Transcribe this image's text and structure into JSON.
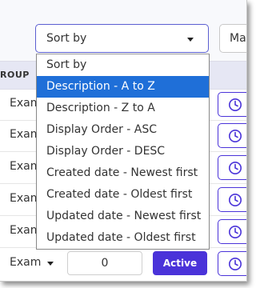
{
  "toolbar": {
    "sort_select_value": "Sort by",
    "second_select_value": "Ma"
  },
  "table": {
    "partial_column_header": "ROUP",
    "rows": [
      {
        "type_label": "Exam"
      },
      {
        "type_label": "Exam"
      },
      {
        "type_label": "Exam"
      },
      {
        "type_label": "Exam"
      },
      {
        "type_label": "Exam"
      },
      {
        "type_label": "Exam",
        "display_order": "0",
        "status_label": "Active"
      }
    ]
  },
  "sort_dropdown": {
    "options": [
      "Sort by",
      "Description - A to Z",
      "Description - Z to A",
      "Display Order - ASC",
      "Display Order - DESC",
      "Created date - Newest first",
      "Created date - Oldest first",
      "Updated date - Newest first",
      "Updated date - Oldest first"
    ],
    "selected_index": 1
  },
  "colors": {
    "accent": "#4a33d9",
    "selection": "#1f6fd8",
    "select_border": "#5b5fd1",
    "header_bg": "#e6e7f4"
  },
  "icons": {
    "row_action": "clock-icon",
    "select_arrow": "caret-down-icon"
  }
}
